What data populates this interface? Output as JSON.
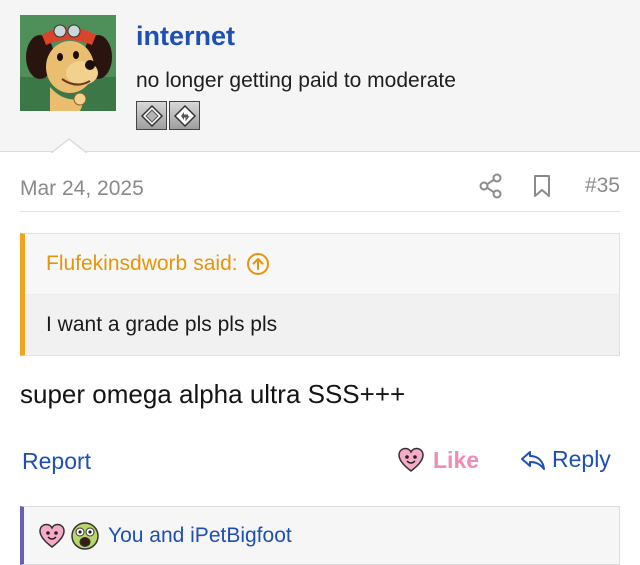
{
  "user": {
    "name": "internet",
    "title": "no longer getting paid to moderate",
    "badges": [
      "diamond-badge-icon",
      "refresh-badge-icon"
    ]
  },
  "post": {
    "date": "Mar 24, 2025",
    "number": "#35",
    "quote": {
      "author": "Flufekinsdworb",
      "said": "said:",
      "text": "I want a grade pls pls pls"
    },
    "message": "super omega alpha ultra SSS+++"
  },
  "actions": {
    "report": "Report",
    "like": "Like",
    "reply": "Reply"
  },
  "reactions": {
    "text": "You and iPetBigfoot"
  },
  "colors": {
    "link": "#1e4fb4",
    "quote_accent": "#f2a31b",
    "like_pink": "#f08bb4",
    "reaction_bar": "#6a5fb8"
  }
}
